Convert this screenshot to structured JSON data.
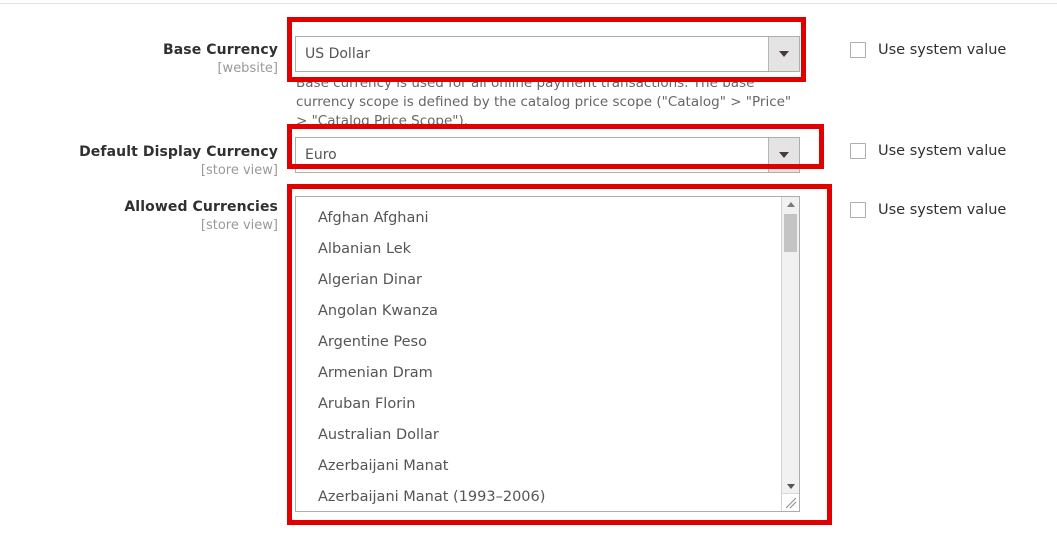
{
  "page": {
    "accent_red": "#e00000",
    "label_color": "#303030",
    "scope_color": "#999999"
  },
  "fields": [
    {
      "label": "Base Currency",
      "scope": "[website]",
      "control": "select",
      "value": "US Dollar",
      "note": "Base currency is used for all online payment transactions. The base currency scope is defined by the catalog price scope (\"Catalog\" > \"Price\" > \"Catalog Price Scope\").",
      "system_value_label": "Use system value",
      "system_value_checked": false,
      "highlighted": true
    },
    {
      "label": "Default Display Currency",
      "scope": "[store view]",
      "control": "select",
      "value": "Euro",
      "note": "",
      "system_value_label": "Use system value",
      "system_value_checked": false,
      "highlighted": true
    },
    {
      "label": "Allowed Currencies",
      "scope": "[store view]",
      "control": "listbox",
      "value": "",
      "note": "",
      "system_value_label": "Use system value",
      "system_value_checked": false,
      "highlighted": true
    }
  ],
  "allowed_currencies": {
    "options": [
      "Afghan Afghani",
      "Albanian Lek",
      "Algerian Dinar",
      "Angolan Kwanza",
      "Argentine Peso",
      "Armenian Dram",
      "Aruban Florin",
      "Australian Dollar",
      "Azerbaijani Manat",
      "Azerbaijani Manat (1993–2006)"
    ],
    "selected": []
  },
  "icons": {
    "select_caret": "chevron-down-icon",
    "scroll_up": "scroll-up-arrow-icon",
    "scroll_down": "scroll-down-arrow-icon",
    "resize_grip": "resize-grip-icon"
  }
}
